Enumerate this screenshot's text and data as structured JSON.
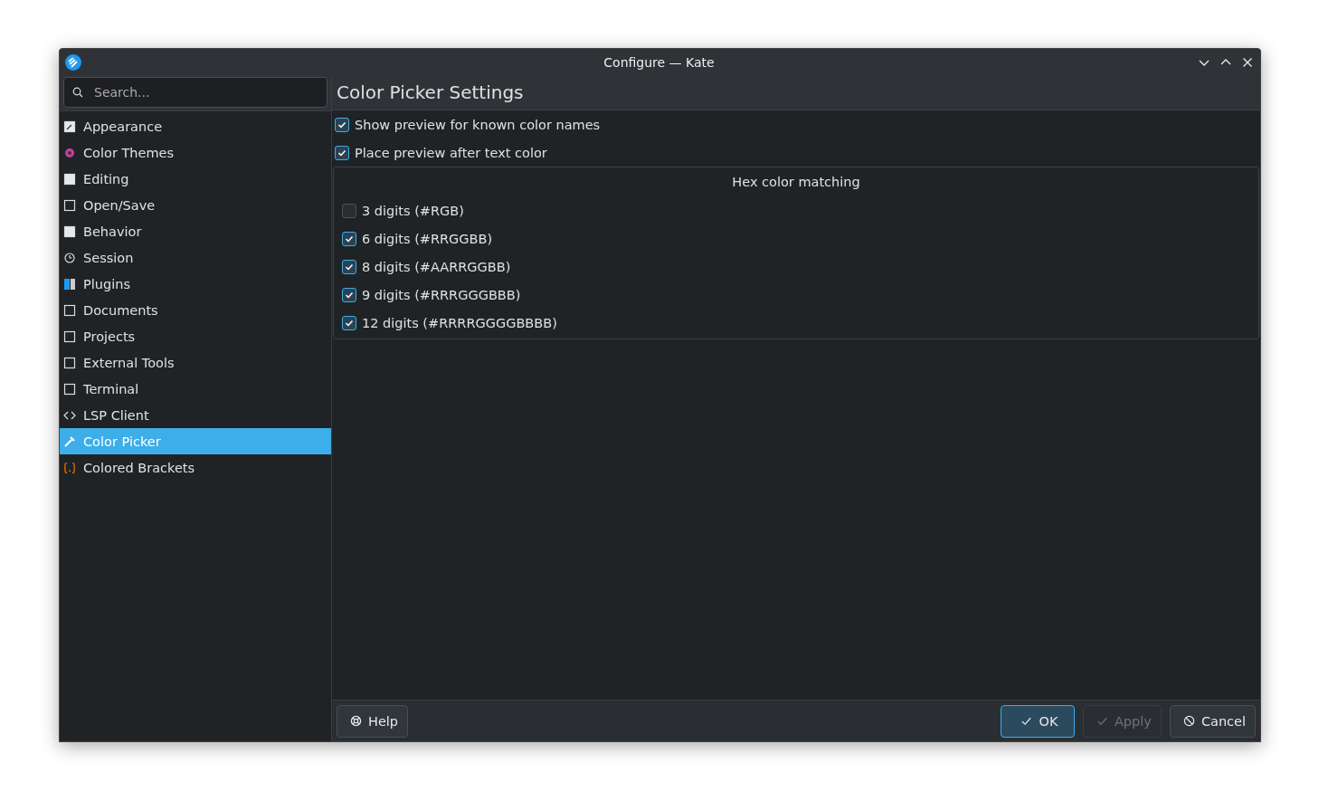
{
  "window": {
    "title": "Configure — Kate"
  },
  "search": {
    "placeholder": "Search..."
  },
  "sidebar": {
    "items": [
      {
        "label": "Appearance",
        "selected": false
      },
      {
        "label": "Color Themes",
        "selected": false
      },
      {
        "label": "Editing",
        "selected": false
      },
      {
        "label": "Open/Save",
        "selected": false
      },
      {
        "label": "Behavior",
        "selected": false
      },
      {
        "label": "Session",
        "selected": false
      },
      {
        "label": "Plugins",
        "selected": false
      },
      {
        "label": "Documents",
        "selected": false
      },
      {
        "label": "Projects",
        "selected": false
      },
      {
        "label": "External Tools",
        "selected": false
      },
      {
        "label": "Terminal",
        "selected": false
      },
      {
        "label": "LSP Client",
        "selected": false
      },
      {
        "label": "Color Picker",
        "selected": true
      },
      {
        "label": "Colored Brackets",
        "selected": false
      }
    ]
  },
  "page": {
    "title": "Color Picker Settings",
    "options": [
      {
        "label": "Show preview for known color names",
        "checked": true
      },
      {
        "label": "Place preview after text color",
        "checked": true
      }
    ],
    "group": {
      "title": "Hex color matching",
      "options": [
        {
          "label": "3 digits (#RGB)",
          "checked": false
        },
        {
          "label": "6 digits (#RRGGBB)",
          "checked": true
        },
        {
          "label": "8 digits (#AARRGGBB)",
          "checked": true
        },
        {
          "label": "9 digits (#RRRGGGBBB)",
          "checked": true
        },
        {
          "label": "12 digits (#RRRRGGGGBBBB)",
          "checked": true
        }
      ]
    }
  },
  "buttons": {
    "left": [
      {
        "label": "Help",
        "kind": "help",
        "default": false,
        "disabled": false
      }
    ],
    "right": [
      {
        "label": "OK",
        "kind": "ok",
        "default": true,
        "disabled": false
      },
      {
        "label": "Apply",
        "kind": "ok",
        "default": false,
        "disabled": true
      },
      {
        "label": "Cancel",
        "kind": "cancel",
        "default": false,
        "disabled": false
      }
    ]
  }
}
